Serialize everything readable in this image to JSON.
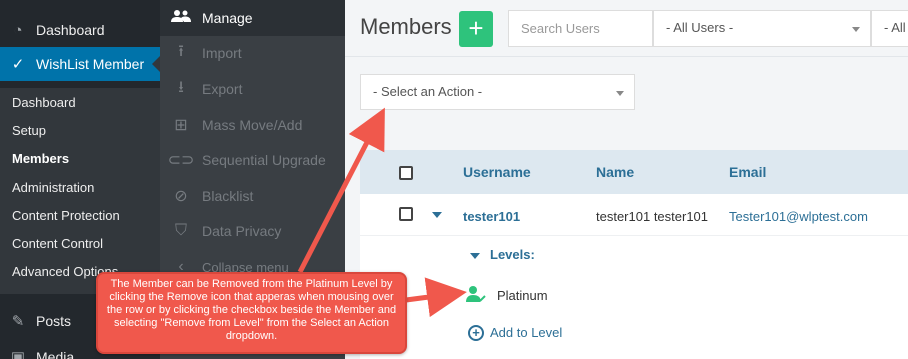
{
  "wp_menu": {
    "dashboard": "Dashboard",
    "wishlist": "WishList Member",
    "submenu": [
      "Dashboard",
      "Setup",
      "Members",
      "Administration",
      "Content Protection",
      "Content Control",
      "Advanced Options"
    ],
    "posts": "Posts",
    "media": "Media"
  },
  "wlm_menu": {
    "items": [
      {
        "label": "Manage",
        "icon": "users-icon"
      },
      {
        "label": "Import",
        "icon": "upload-icon"
      },
      {
        "label": "Export",
        "icon": "download-icon"
      },
      {
        "label": "Mass Move/Add",
        "icon": "plus-square-icon"
      },
      {
        "label": "Sequential Upgrade",
        "icon": "link-icon"
      },
      {
        "label": "Blacklist",
        "icon": "ban-icon"
      },
      {
        "label": "Data Privacy",
        "icon": "shield-check-icon"
      }
    ],
    "collapse": "Collapse menu"
  },
  "header": {
    "title": "Members",
    "add_label": "+",
    "search_placeholder": "Search Users",
    "filter_users": "- All Users -",
    "filter_levels": "- All Levels -"
  },
  "bulk_action": {
    "placeholder": "- Select an Action -"
  },
  "table": {
    "columns": [
      "Username",
      "Name",
      "Email"
    ],
    "rows": [
      {
        "username": "tester101",
        "name": "tester101 tester101",
        "email": "Tester101@wlptest.com",
        "levels_label": "Levels:",
        "levels": [
          "Platinum"
        ],
        "add_level": "Add to Level"
      }
    ]
  },
  "annotation": {
    "text": "The Member can be Removed from the Platinum Level by clicking the Remove icon that apperas when mousing over the row or by clicking the checkbox beside the Member and selecting \"Remove from Level\" from the Select an Action dropdown."
  },
  "colors": {
    "wp_sidebar": "#23282d",
    "wp_active": "#0073aa",
    "wlm_sidebar": "#3a3f44",
    "accent_green": "#2ec37c",
    "link_blue": "#2c6f96",
    "callout_red": "#f0584c"
  }
}
